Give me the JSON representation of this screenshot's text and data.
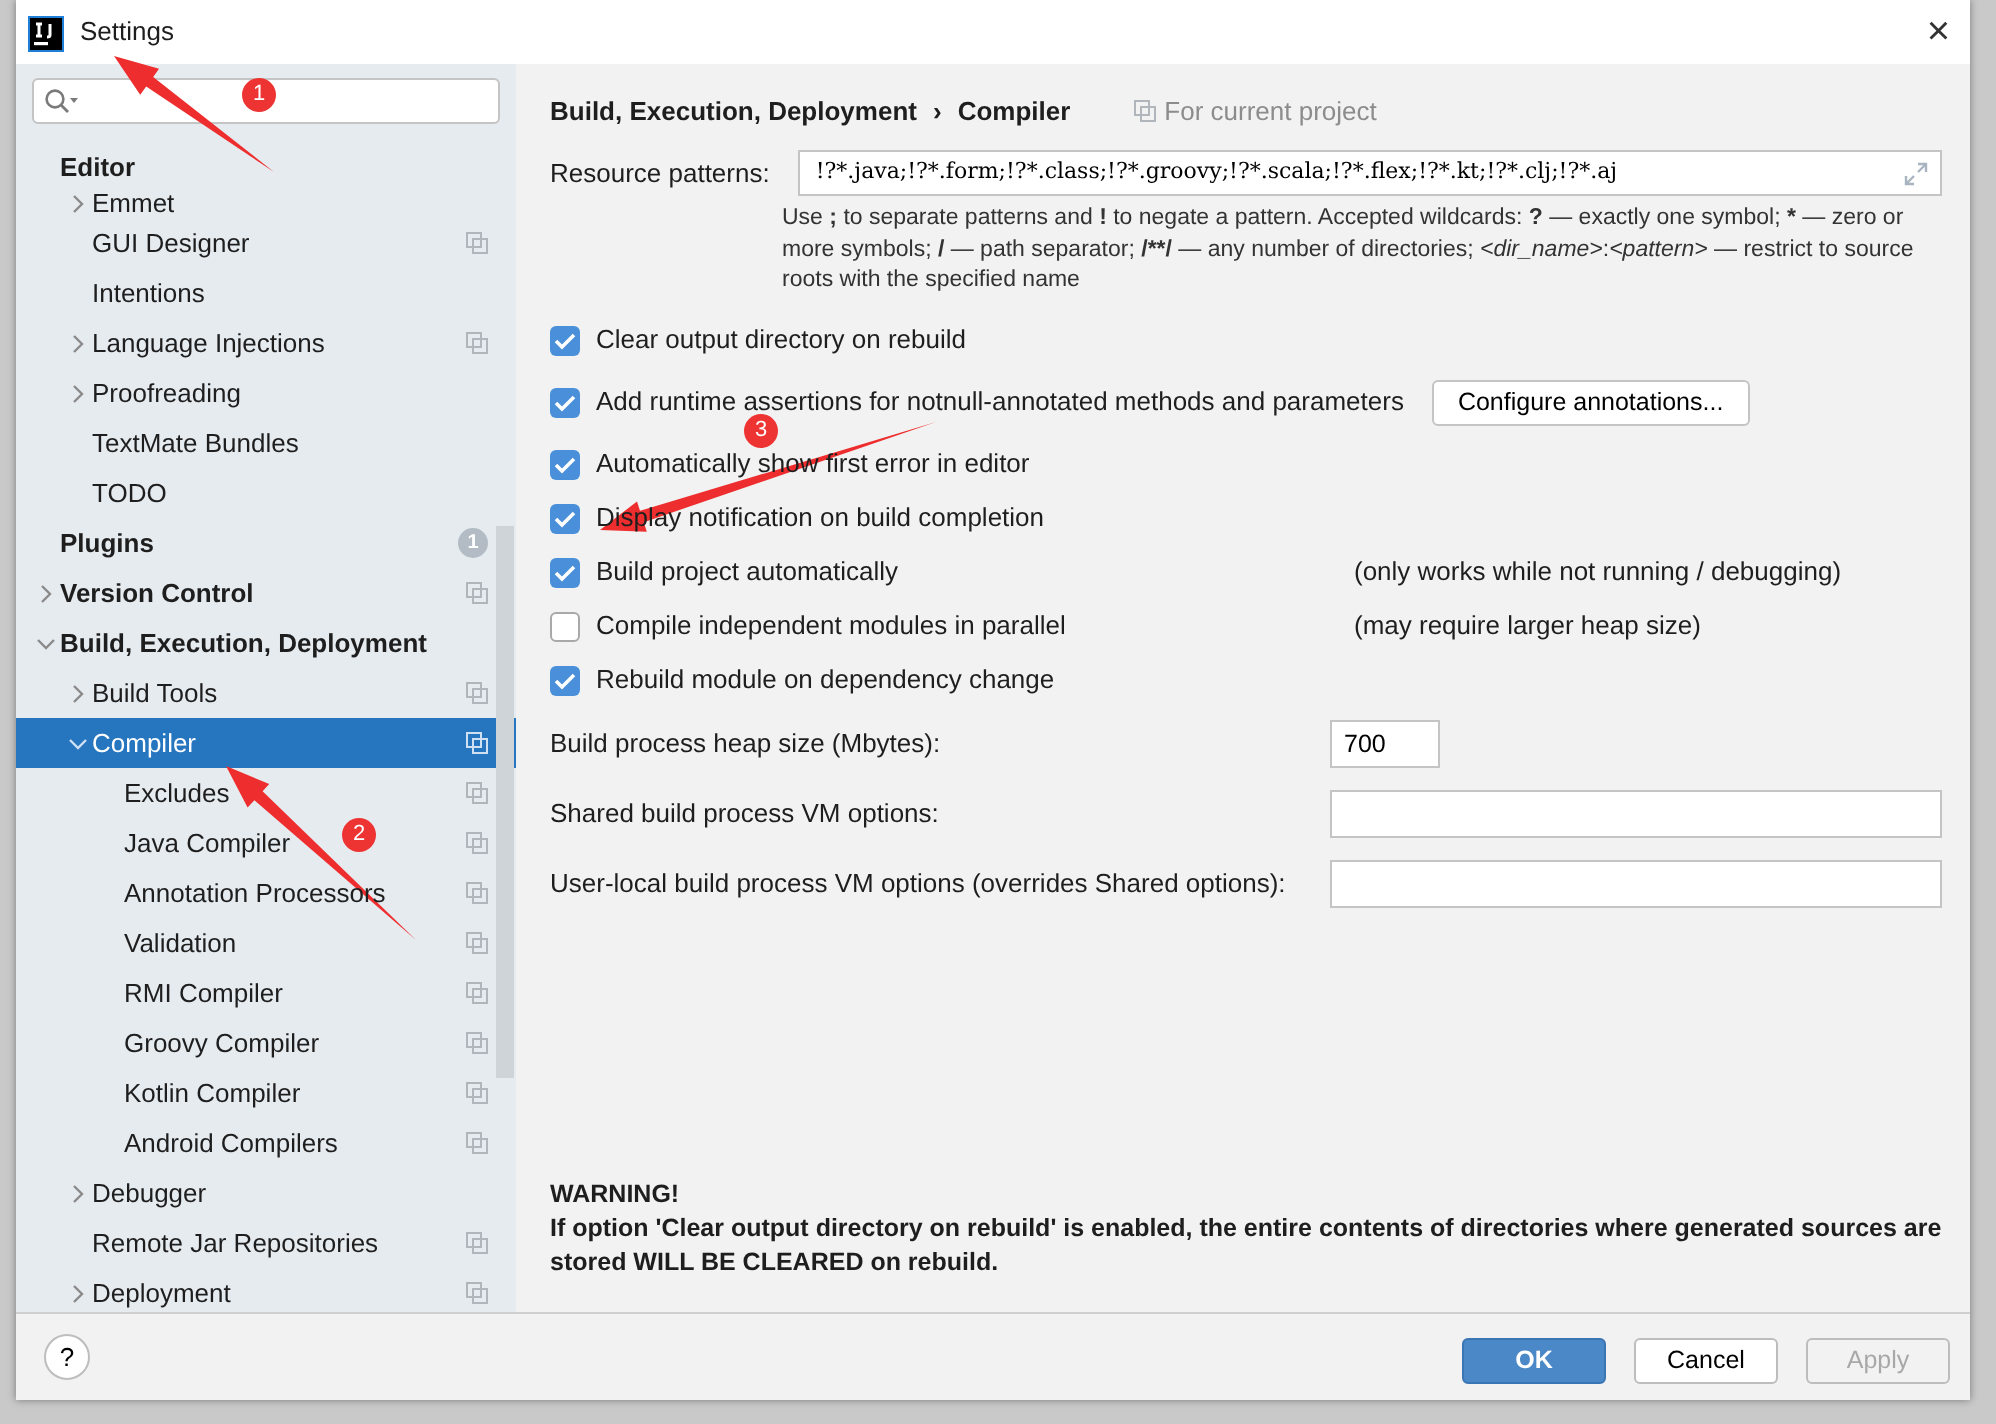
{
  "window": {
    "title": "Settings",
    "close": "×"
  },
  "tree": [
    {
      "label": "Editor",
      "selected": false,
      "children": [
        {
          "label": "Emmet",
          "expanded": false,
          "selected": false
        },
        {
          "label": "GUI Designer",
          "project_scope": true,
          "selected": false
        },
        {
          "label": "Intentions",
          "selected": false
        },
        {
          "label": "Language Injections",
          "expanded": false,
          "project_scope": true,
          "selected": false
        },
        {
          "label": "Proofreading",
          "expanded": false,
          "selected": false
        },
        {
          "label": "TextMate Bundles",
          "selected": false
        },
        {
          "label": "TODO",
          "selected": false
        }
      ]
    },
    {
      "label": "Plugins",
      "badge": "1",
      "selected": false
    },
    {
      "label": "Version Control",
      "expanded": false,
      "project_scope": true,
      "selected": false
    },
    {
      "label": "Build, Execution, Deployment",
      "expanded": true,
      "selected": false,
      "children": [
        {
          "label": "Build Tools",
          "expanded": false,
          "project_scope": true,
          "selected": false
        },
        {
          "label": "Compiler",
          "expanded": true,
          "project_scope": true,
          "selected": true,
          "children": [
            {
              "label": "Excludes",
              "project_scope": true,
              "selected": false
            },
            {
              "label": "Java Compiler",
              "project_scope": true,
              "selected": false
            },
            {
              "label": "Annotation Processors",
              "project_scope": true,
              "selected": false
            },
            {
              "label": "Validation",
              "project_scope": true,
              "selected": false
            },
            {
              "label": "RMI Compiler",
              "project_scope": true,
              "selected": false
            },
            {
              "label": "Groovy Compiler",
              "project_scope": true,
              "selected": false
            },
            {
              "label": "Kotlin Compiler",
              "project_scope": true,
              "selected": false
            },
            {
              "label": "Android Compilers",
              "project_scope": true,
              "selected": false
            }
          ]
        },
        {
          "label": "Debugger",
          "expanded": false,
          "selected": false
        },
        {
          "label": "Remote Jar Repositories",
          "project_scope": true,
          "selected": false
        },
        {
          "label": "Deployment",
          "expanded": false,
          "project_scope": true,
          "selected": false
        }
      ]
    }
  ],
  "breadcrumb": {
    "parent": "Build, Execution, Deployment",
    "separator": "›",
    "current": "Compiler",
    "scope": "For current project"
  },
  "resource_patterns": {
    "label": "Resource patterns:",
    "value": "!?*.java;!?*.form;!?*.class;!?*.groovy;!?*.scala;!?*.flex;!?*.kt;!?*.clj;!?*.aj",
    "hint": [
      {
        "text": "Use ",
        "kind": "text"
      },
      {
        "text": ";",
        "kind": "symbol"
      },
      {
        "text": " to separate patterns and ",
        "kind": "text"
      },
      {
        "text": "!",
        "kind": "symbol"
      },
      {
        "text": " to negate a pattern. Accepted wildcards: ",
        "kind": "text"
      },
      {
        "text": "?",
        "kind": "symbol"
      },
      {
        "text": " — exactly one symbol; ",
        "kind": "text"
      },
      {
        "text": "*",
        "kind": "symbol"
      },
      {
        "text": " — zero or more symbols; ",
        "kind": "text"
      },
      {
        "text": "/",
        "kind": "symbol"
      },
      {
        "text": " — path separator; ",
        "kind": "text"
      },
      {
        "text": "/**/",
        "kind": "symbol"
      },
      {
        "text": " — any number of directories; ",
        "kind": "text"
      },
      {
        "text": "<dir_name>",
        "kind": "token"
      },
      {
        "text": ":",
        "kind": "text"
      },
      {
        "text": "<pattern>",
        "kind": "token"
      },
      {
        "text": " — restrict to source roots with the specified name",
        "kind": "text"
      }
    ]
  },
  "options": [
    {
      "label": "Clear output directory on rebuild",
      "checked": true
    },
    {
      "label": "Add runtime assertions for notnull-annotated methods and parameters",
      "checked": true,
      "button": "Configure annotations..."
    },
    {
      "label": "Automatically show first error in editor",
      "checked": true
    },
    {
      "label": "Display notification on build completion",
      "checked": true
    },
    {
      "label": "Build project automatically",
      "checked": true,
      "note": "(only works while not running / debugging)"
    },
    {
      "label": "Compile independent modules in parallel",
      "checked": false,
      "note": "(may require larger heap size)"
    },
    {
      "label": "Rebuild module on dependency change",
      "checked": true
    }
  ],
  "fields": [
    {
      "label": "Build process heap size (Mbytes):",
      "value": "700"
    },
    {
      "label": "Shared build process VM options:"
    },
    {
      "label": "User-local build process VM options (overrides Shared options):"
    }
  ],
  "warning": {
    "title": "WARNING!",
    "text": "If option 'Clear output directory on rebuild' is enabled, the entire contents of directories where generated sources are stored WILL BE CLEARED on rebuild."
  },
  "footer": {
    "help": "?",
    "buttons": [
      {
        "label": "OK",
        "kind": "primary",
        "disabled": false
      },
      {
        "label": "Cancel",
        "kind": "default",
        "disabled": false
      },
      {
        "label": "Apply",
        "kind": "default",
        "disabled": true
      }
    ]
  },
  "annotations": [
    {
      "number": "1"
    },
    {
      "number": "2"
    },
    {
      "number": "3"
    }
  ]
}
